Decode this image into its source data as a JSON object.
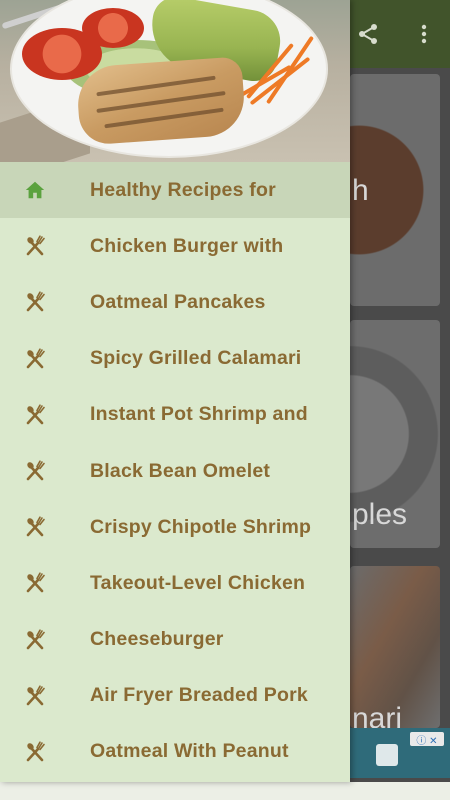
{
  "app_bar": {
    "background_color": "#41542b",
    "actions": [
      {
        "name": "share-icon",
        "glyph": "⋖"
      },
      {
        "name": "more-vert-icon",
        "glyph": "⋮"
      }
    ]
  },
  "background_cards": [
    {
      "visible_text": "h"
    },
    {
      "visible_text": "ples"
    },
    {
      "visible_text": "nari"
    }
  ],
  "ad": {
    "info_label": "ⓘ ✕"
  },
  "drawer": {
    "background_color": "#dbe9cd",
    "active_color": "#c8d6b8",
    "label_color": "#8a6a33",
    "home_icon_color": "#5ba23e",
    "items": [
      {
        "label": "Healthy Recipes for",
        "icon": "home-icon",
        "active": true
      },
      {
        "label": "Chicken Burger with",
        "icon": "fork-knife-icon",
        "active": false
      },
      {
        "label": "Oatmeal Pancakes",
        "icon": "fork-knife-icon",
        "active": false
      },
      {
        "label": "Spicy Grilled Calamari",
        "icon": "fork-knife-icon",
        "active": false
      },
      {
        "label": "Instant Pot Shrimp and",
        "icon": "fork-knife-icon",
        "active": false
      },
      {
        "label": "Black Bean Omelet",
        "icon": "fork-knife-icon",
        "active": false
      },
      {
        "label": "Crispy Chipotle Shrimp",
        "icon": "fork-knife-icon",
        "active": false
      },
      {
        "label": "Takeout-Level Chicken",
        "icon": "fork-knife-icon",
        "active": false
      },
      {
        "label": "Cheeseburger",
        "icon": "fork-knife-icon",
        "active": false
      },
      {
        "label": "Air Fryer Breaded Pork",
        "icon": "fork-knife-icon",
        "active": false
      },
      {
        "label": "Oatmeal With Peanut",
        "icon": "fork-knife-icon",
        "active": false
      }
    ]
  }
}
